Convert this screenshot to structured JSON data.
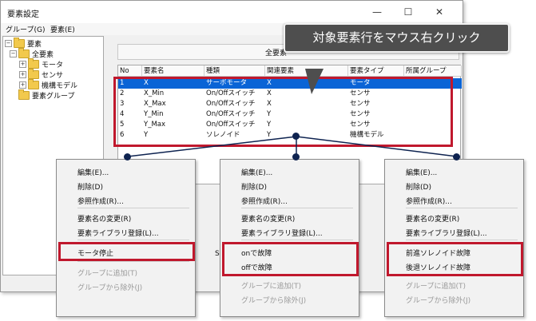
{
  "window": {
    "title": "要素設定",
    "controls": {
      "minimize": "—",
      "maximize": "☐",
      "close": "✕"
    },
    "menus": [
      "グループ(G)",
      "要素(E)"
    ]
  },
  "tree": {
    "root": "要素",
    "all": "全要素",
    "children": [
      "モータ",
      "センサ",
      "機構モデル"
    ],
    "group": "要素グループ"
  },
  "panel": {
    "filter_label": "全要素"
  },
  "grid": {
    "columns": [
      "No",
      "要素名",
      "種類",
      "関連要素",
      "要素タイプ",
      "所属グループ"
    ],
    "rows": [
      [
        "1",
        "X",
        "サーボモータ",
        "X",
        "モータ",
        ""
      ],
      [
        "2",
        "X_Min",
        "On/Offスイッチ",
        "X",
        "センサ",
        ""
      ],
      [
        "3",
        "X_Max",
        "On/Offスイッチ",
        "X",
        "センサ",
        ""
      ],
      [
        "4",
        "Y_Min",
        "On/Offスイッチ",
        "Y",
        "センサ",
        ""
      ],
      [
        "5",
        "Y_Max",
        "On/Offスイッチ",
        "Y",
        "センサ",
        ""
      ],
      [
        "6",
        "Y",
        "ソレノイド",
        "Y",
        "機構モデル",
        ""
      ]
    ]
  },
  "callout": {
    "text": "対象要素行をマウス右クリック"
  },
  "bottom_button_fragment": "S",
  "menus_common": {
    "edit": "編集(E)...",
    "delete": "削除(D)",
    "ref": "参照作成(R)...",
    "rename": "要素名の変更(R)",
    "library": "要素ライブラリ登録(L)...",
    "add_group": "グループに追加(T)",
    "remove_group": "グループから除外(J)"
  },
  "menu_left": {
    "special": [
      "モータ停止"
    ]
  },
  "menu_mid": {
    "special": [
      "onで故障",
      "offで故障"
    ]
  },
  "menu_right": {
    "special": [
      "前進ソレノイド故障",
      "後退ソレノイド故障"
    ]
  },
  "colors": {
    "selection": "#0a64d6",
    "highlight": "#c0182d",
    "callout": "#4e4e4e",
    "connector": "#0e2350"
  }
}
